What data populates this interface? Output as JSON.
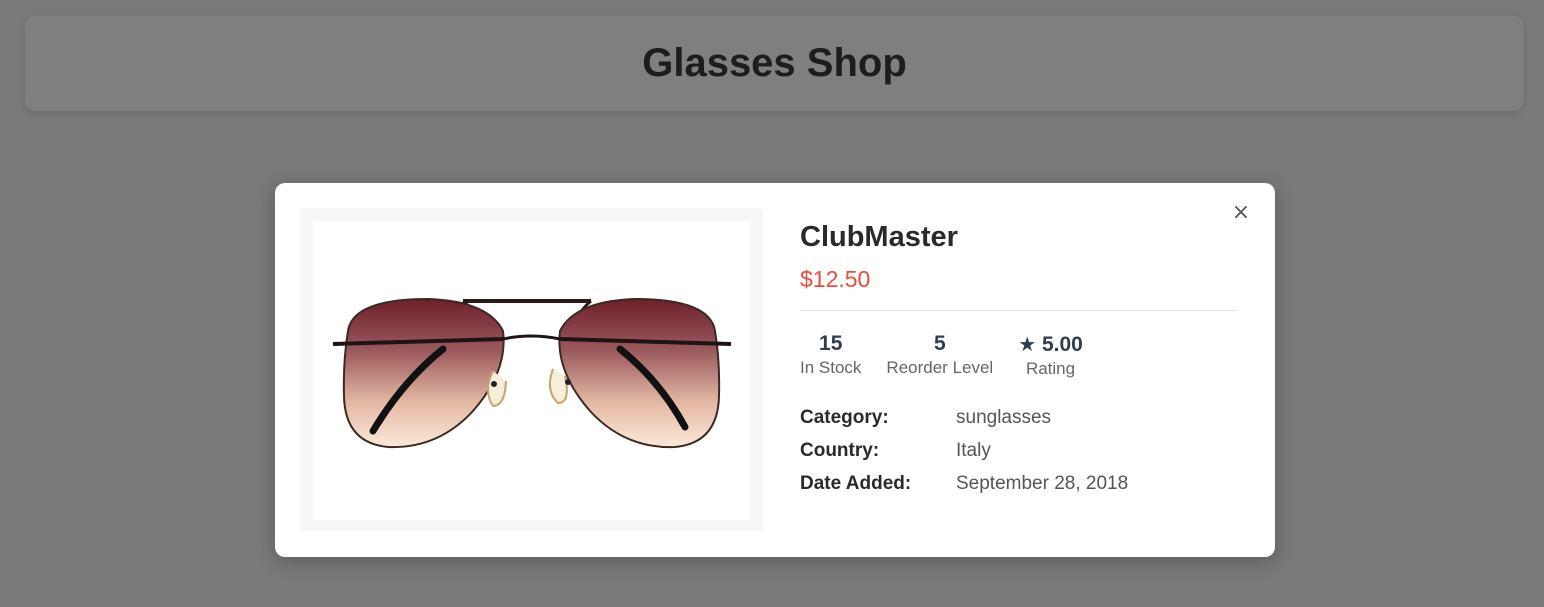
{
  "header": {
    "title": "Glasses Shop"
  },
  "modal": {
    "close_label": "×",
    "product": {
      "name": "ClubMaster",
      "price": "$12.50",
      "image_alt": "sunglasses-product-image"
    },
    "stats": [
      {
        "value": "15",
        "label": "In Stock"
      },
      {
        "value": "5",
        "label": "Reorder Level"
      },
      {
        "icon": "star-icon",
        "value": "5.00",
        "label": "Rating"
      }
    ],
    "info": [
      {
        "label": "Category:",
        "value": "sunglasses"
      },
      {
        "label": "Country:",
        "value": "Italy"
      },
      {
        "label": "Date Added:",
        "value": "September 28, 2018"
      }
    ]
  },
  "colors": {
    "price": "#e74c3c",
    "stat_value": "#2c3e50",
    "overlay": "rgba(0,0,0,0.5)"
  }
}
